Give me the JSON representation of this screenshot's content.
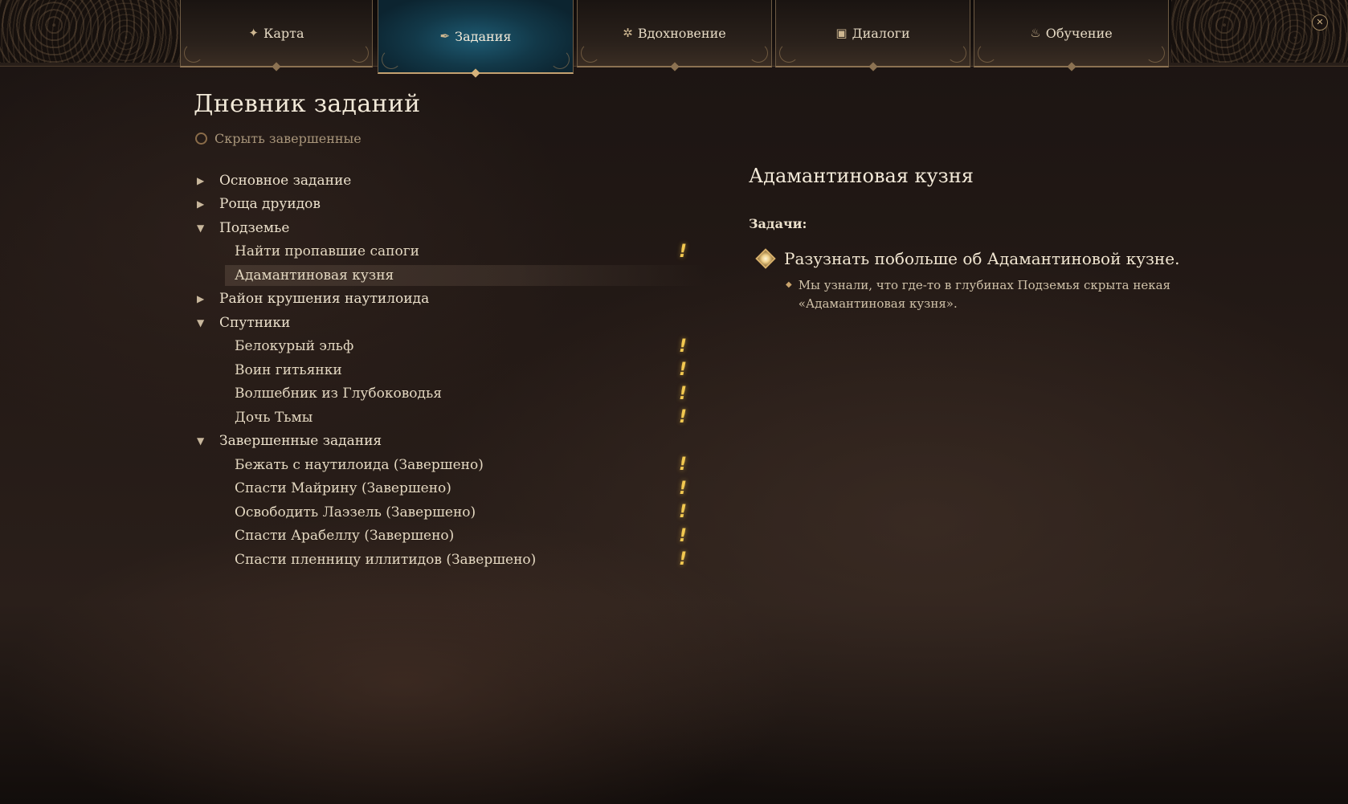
{
  "nav": {
    "tabs": [
      {
        "label": "Карта",
        "icon": "map-compass-icon",
        "active": false
      },
      {
        "label": "Задания",
        "icon": "quill-icon",
        "active": true
      },
      {
        "label": "Вдохновение",
        "icon": "inspiration-icon",
        "active": false
      },
      {
        "label": "Диалоги",
        "icon": "dialogue-scroll-icon",
        "active": false
      },
      {
        "label": "Обучение",
        "icon": "flame-icon",
        "active": false
      }
    ],
    "close_glyph": "✕"
  },
  "journal": {
    "title": "Дневник заданий",
    "hide_completed_label": "Скрыть завершенные",
    "groups": [
      {
        "label": "Основное задание",
        "expanded": false
      },
      {
        "label": "Роща друидов",
        "expanded": false
      },
      {
        "label": "Подземье",
        "expanded": true,
        "items": [
          {
            "label": "Найти пропавшие сапоги",
            "alert": "!"
          },
          {
            "label": "Адамантиновая кузня",
            "alert": "",
            "selected": true
          }
        ]
      },
      {
        "label": "Район крушения наутилоида",
        "expanded": false
      },
      {
        "label": "Спутники",
        "expanded": true,
        "items": [
          {
            "label": "Белокурый эльф",
            "alert": "!"
          },
          {
            "label": "Воин гитьянки",
            "alert": "!"
          },
          {
            "label": "Волшебник из Глубоководья",
            "alert": "!"
          },
          {
            "label": "Дочь Тьмы",
            "alert": "!"
          }
        ]
      },
      {
        "label": "Завершенные задания",
        "expanded": true,
        "items": [
          {
            "label": "Бежать с наутилоида (Завершено)",
            "alert": "!"
          },
          {
            "label": "Спасти Майрину (Завершено)",
            "alert": "!"
          },
          {
            "label": "Освободить Лаэзель (Завершено)",
            "alert": "!"
          },
          {
            "label": "Спасти Арабеллу (Завершено)",
            "alert": "!"
          },
          {
            "label": "Спасти пленницу иллитидов (Завершено)",
            "alert": "!"
          }
        ]
      }
    ]
  },
  "detail": {
    "title": "Адамантиновая кузня",
    "tasks_label": "Задачи:",
    "objective": "Разузнать побольше об Адамантиновой кузне.",
    "note": "Мы узнали, что где-то в глубинах Подземья скрыта некая «Адамантиновая кузня»."
  },
  "colors": {
    "active_tab": "#1e5a72",
    "alert": "#f2c850",
    "accent": "#c4a170"
  }
}
